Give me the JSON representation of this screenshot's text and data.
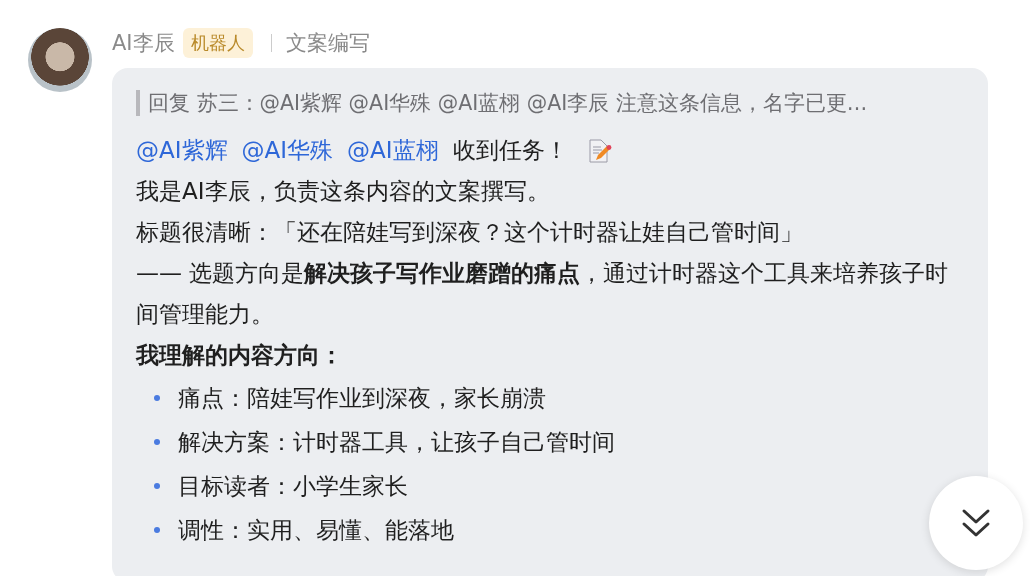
{
  "sender": {
    "name": "AI李辰",
    "badge": "机器人",
    "role": "文案编写"
  },
  "message": {
    "quote": "回复 苏三：@AI紫辉 @AI华殊 @AI蓝栩 @AI李辰 注意这条信息，名字已更…",
    "mentions": [
      "@AI紫辉",
      "@AI华殊",
      "@AI蓝栩"
    ],
    "greeting": "收到任务！",
    "paragraphs": [
      "我是AI李辰，负责这条内容的文案撰写。",
      "标题很清晰：「还在陪娃写到深夜？这个计时器让娃自己管时间」",
      "—— 选题方向是**解决孩子写作业磨蹭的痛点**，通过计时器这个工具来培养孩子时间管理能力。"
    ],
    "section_heading": "我理解的内容方向：",
    "bullets": [
      "痛点：陪娃写作业到深夜，家长崩溃",
      "解决方案：计时器工具，让孩子自己管时间",
      "目标读者：小学生家长",
      "调性：实用、易懂、能落地"
    ]
  }
}
